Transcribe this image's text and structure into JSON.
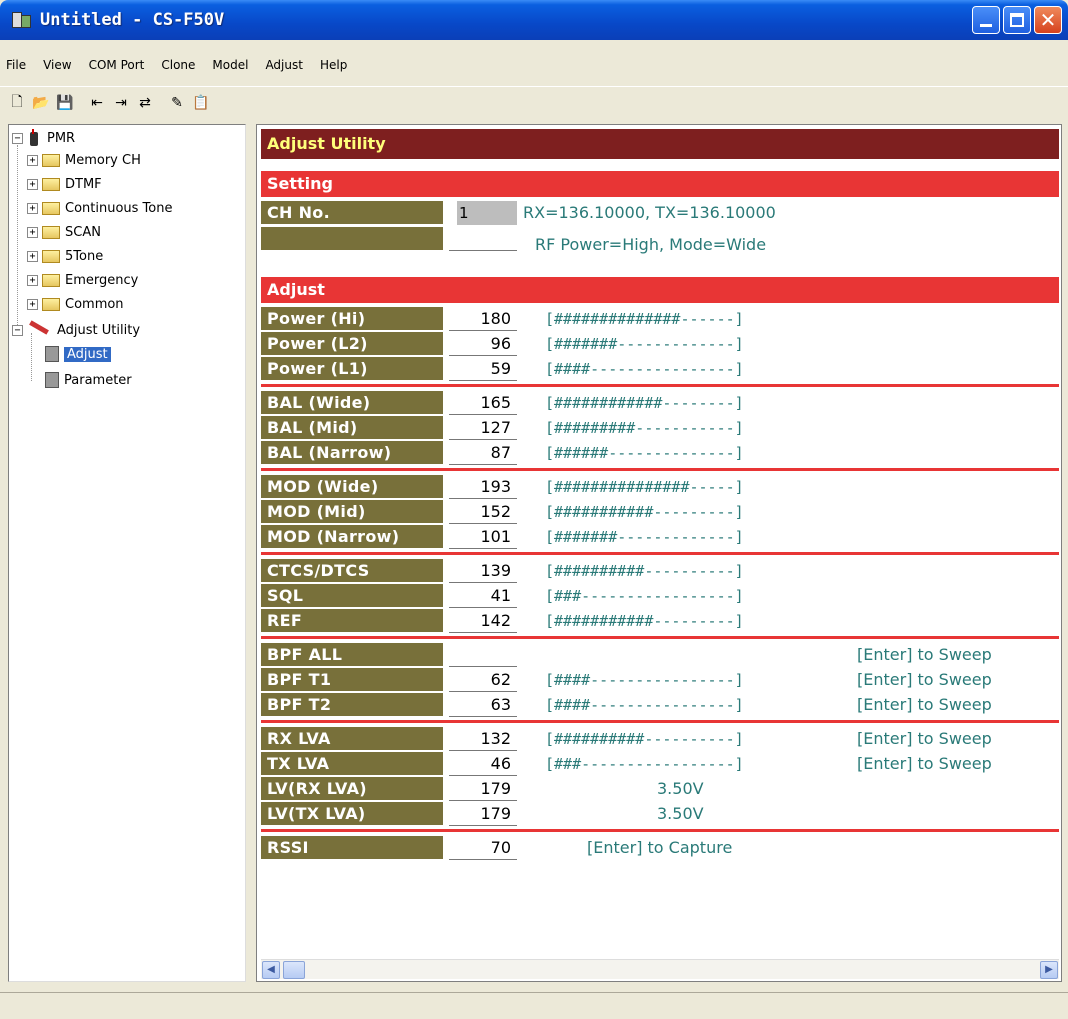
{
  "window": {
    "title": "Untitled - CS-F50V"
  },
  "menu": [
    "File",
    "View",
    "COM Port",
    "Clone",
    "Model",
    "Adjust",
    "Help"
  ],
  "toolbar": {
    "icons": [
      "new-file-icon",
      "open-folder-icon",
      "save-icon",
      "read-radio-icon",
      "write-radio-icon",
      "clone-radio-icon",
      "adjust-tool-icon",
      "paste-icon"
    ]
  },
  "tree": {
    "root": "PMR",
    "children": [
      "Memory CH",
      "DTMF",
      "Continuous Tone",
      "SCAN",
      "5Tone",
      "Emergency",
      "Common"
    ],
    "adjust_utility": "Adjust Utility",
    "adjust_children": [
      "Adjust",
      "Parameter"
    ]
  },
  "panel": {
    "header": "Adjust Utility",
    "setting_section": "Setting",
    "ch_label": "CH No.",
    "ch_value": "1",
    "rx_tx": "RX=136.10000, TX=136.10000",
    "rf_mode": "RF Power=High, Mode=Wide",
    "adjust_section": "Adjust",
    "rows": [
      {
        "label": "Power (Hi)",
        "value": "180",
        "bar": "[##############------]"
      },
      {
        "label": "Power (L2)",
        "value": "96",
        "bar": "[#######-------------]"
      },
      {
        "label": "Power (L1)",
        "value": "59",
        "bar": "[####----------------]"
      },
      {
        "label": "BAL (Wide)",
        "value": "165",
        "bar": "[############--------]"
      },
      {
        "label": "BAL (Mid)",
        "value": "127",
        "bar": "[#########-----------]"
      },
      {
        "label": "BAL (Narrow)",
        "value": "87",
        "bar": "[######--------------]"
      },
      {
        "label": "MOD (Wide)",
        "value": "193",
        "bar": "[###############-----]"
      },
      {
        "label": "MOD (Mid)",
        "value": "152",
        "bar": "[###########---------]"
      },
      {
        "label": "MOD (Narrow)",
        "value": "101",
        "bar": "[#######-------------]"
      },
      {
        "label": "CTCS/DTCS",
        "value": "139",
        "bar": "[##########----------]"
      },
      {
        "label": "SQL",
        "value": "41",
        "bar": "[###-----------------]"
      },
      {
        "label": "REF",
        "value": "142",
        "bar": "[###########---------]"
      },
      {
        "label": "BPF ALL",
        "value": "",
        "bar": "",
        "sweep": "[Enter] to Sweep"
      },
      {
        "label": "BPF T1",
        "value": "62",
        "bar": "[####----------------]",
        "sweep": "[Enter] to Sweep"
      },
      {
        "label": "BPF T2",
        "value": "63",
        "bar": "[####----------------]",
        "sweep": "[Enter] to Sweep"
      },
      {
        "label": "RX LVA",
        "value": "132",
        "bar": "[##########----------]",
        "sweep": "[Enter] to Sweep"
      },
      {
        "label": "TX LVA",
        "value": "46",
        "bar": "[###-----------------]",
        "sweep": "[Enter] to Sweep"
      },
      {
        "label": "LV(RX LVA)",
        "value": "179",
        "volt": "3.50V"
      },
      {
        "label": "LV(TX LVA)",
        "value": "179",
        "volt": "3.50V"
      },
      {
        "label": "RSSI",
        "value": "70",
        "capture": "[Enter] to Capture"
      }
    ]
  },
  "colors": {
    "header_bg": "#7e1f1f",
    "header_text": "#ffff7a",
    "section_bg": "#e83535",
    "label_bg": "#78703a",
    "info_text": "#2a7a78",
    "selection": "#316ac5"
  }
}
